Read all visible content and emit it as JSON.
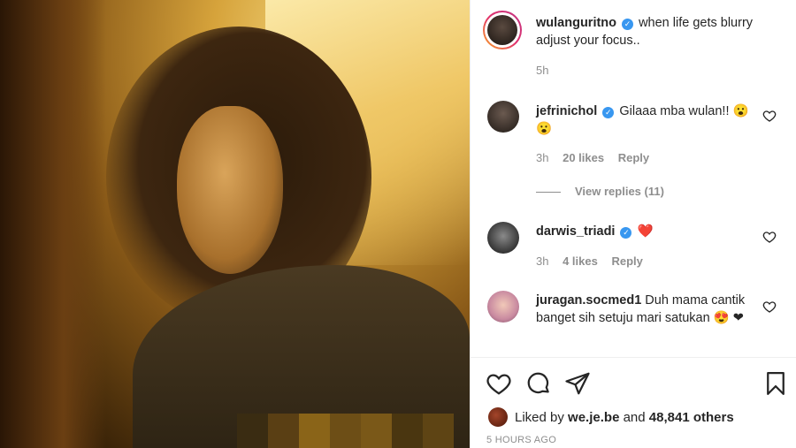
{
  "post": {
    "author": "wulanguritno",
    "caption": "when life gets blurry adjust your focus..",
    "time": "5h"
  },
  "comments": [
    {
      "username": "jefrinichol",
      "verified": true,
      "text": "Gilaaa mba wulan!! 😮😮",
      "time": "3h",
      "likes": "20 likes",
      "reply": "Reply",
      "view_replies": "View replies (11)"
    },
    {
      "username": "darwis_triadi",
      "verified": true,
      "text": "❤️",
      "time": "3h",
      "likes": "4 likes",
      "reply": "Reply"
    },
    {
      "username": "juragan.socmed1",
      "verified": false,
      "text": "Duh mama cantik banget sih setuju mari satukan 😍 ❤"
    }
  ],
  "footer": {
    "liked_by_prefix": "Liked by",
    "liked_by_user": "we.je.be",
    "and": "and",
    "others": "48,841 others",
    "timestamp": "5 HOURS AGO"
  },
  "colors": {
    "verified": "#3897f0",
    "muted": "#8e8e8e",
    "text": "#262626",
    "heart": "#ed1c24"
  },
  "icons": [
    "like-icon",
    "comment-icon",
    "share-icon",
    "bookmark-icon",
    "verified-badge-icon",
    "comment-like-icon"
  ]
}
